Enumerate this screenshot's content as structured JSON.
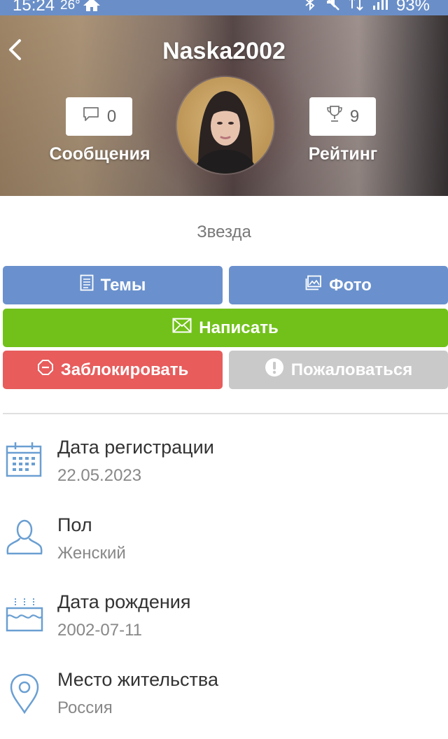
{
  "status_bar": {
    "time": "15:24",
    "temperature": "26°",
    "battery": "93%"
  },
  "header": {
    "title": "Naska2002",
    "messages": {
      "count": "0",
      "label": "Сообщения",
      "icon": "speech-bubble-icon"
    },
    "rating": {
      "count": "9",
      "label": "Рейтинг",
      "icon": "trophy-icon"
    }
  },
  "profile": {
    "status": "Звезда"
  },
  "actions": {
    "topics": "Темы",
    "photo": "Фото",
    "write": "Написать",
    "block": "Заблокировать",
    "report": "Пожаловаться"
  },
  "info": [
    {
      "label": "Дата регистрации",
      "value": "22.05.2023",
      "icon": "calendar-icon"
    },
    {
      "label": "Пол",
      "value": "Женский",
      "icon": "user-icon"
    },
    {
      "label": "Дата рождения",
      "value": "2002-07-11",
      "icon": "cake-icon"
    },
    {
      "label": "Место жительства",
      "value": "Россия",
      "icon": "location-pin-icon"
    }
  ],
  "colors": {
    "status_bar": "#6a8fc8",
    "primary_button": "#6a91cd",
    "write_button": "#72c11a",
    "block_button": "#e85c5c",
    "report_button": "#c9c9c9",
    "icon_blue": "#6a9fd2"
  }
}
